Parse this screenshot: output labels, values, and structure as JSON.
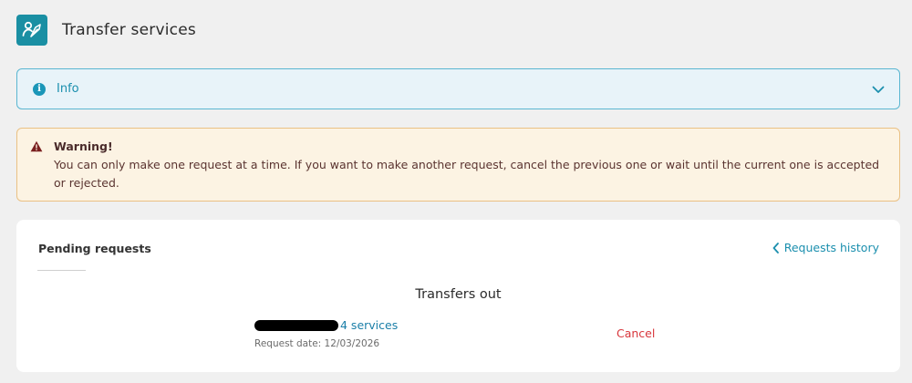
{
  "header": {
    "icon": "transfer-user-icon",
    "title": "Transfer services"
  },
  "info": {
    "icon": "info-icon",
    "label": "Info",
    "expanded": false,
    "chevron": "chevron-down-icon"
  },
  "warning": {
    "icon": "warning-icon",
    "title": "Warning!",
    "message": "You can only make one request at a time. If you want to make another request, cancel the previous one or wait until the current one is accepted or rejected."
  },
  "card": {
    "tab_label": "Pending requests",
    "history_link": "Requests history",
    "section_title": "Transfers out",
    "request": {
      "services_link": "4 services",
      "date_label": "Request date: 12/03/2026",
      "cancel_label": "Cancel"
    }
  },
  "colors": {
    "accent": "#1b8fae",
    "header_icon_bg": "#1a8fa3",
    "info_bg": "#e8f3f9",
    "info_border": "#5ab6d1",
    "warning_bg": "#fcf3e3",
    "warning_border": "#eac184",
    "warning_icon": "#7a1f1f",
    "cancel": "#d8363c"
  }
}
